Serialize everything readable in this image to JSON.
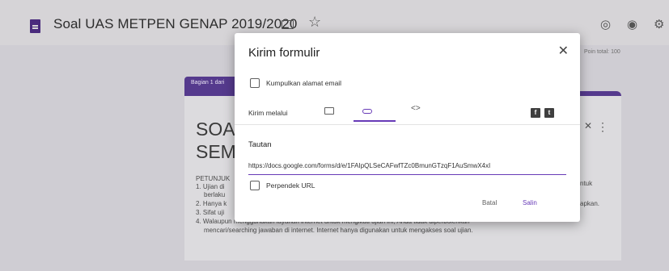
{
  "header": {
    "title": "Soal UAS METPEN GENAP 2019/2020",
    "icons": [
      "doc-icon",
      "folder-icon",
      "star-icon",
      "palette-icon",
      "eye-icon",
      "gear-icon"
    ],
    "total_points": "Poin total: 100"
  },
  "form": {
    "section_tag": "Bagian 1 dari",
    "title_line1": "SOA",
    "title_line2": "SEM",
    "instructions_heading": "PETUNJUK",
    "instructions": [
      "1. Ujian di",
      "berlaku",
      "2. Hanya k",
      "3. Sifat uji",
      "4. Walaupun menggunakan layanan internet untuk mengikuti ujian ini, Anda tidak diperbolehkan",
      "mencari/searching jawaban di internet. Internet hanya digunakan untuk mengakses soal ujian."
    ],
    "right_fragment_1": "ntuk",
    "right_fragment_2": "apkan."
  },
  "dialog": {
    "title": "Kirim formulir",
    "collect_email_label": "Kumpulkan alamat email",
    "send_via_label": "Kirim melalui",
    "tabs": [
      "mail-icon",
      "link-icon",
      "embed-icon"
    ],
    "active_tab": "link-icon",
    "embed_glyph": "<>",
    "facebook_glyph": "f",
    "twitter_glyph": "t",
    "link_section_title": "Tautan",
    "link_url": "https://docs.google.com/forms/d/e/1FAIpQLSeCAFwfTZc0BmunGTzqF1AuSmwX4xI",
    "shorten_url_label": "Perpendek URL",
    "cancel_label": "Batal",
    "copy_label": "Salin",
    "accent_color": "#673ab7"
  }
}
